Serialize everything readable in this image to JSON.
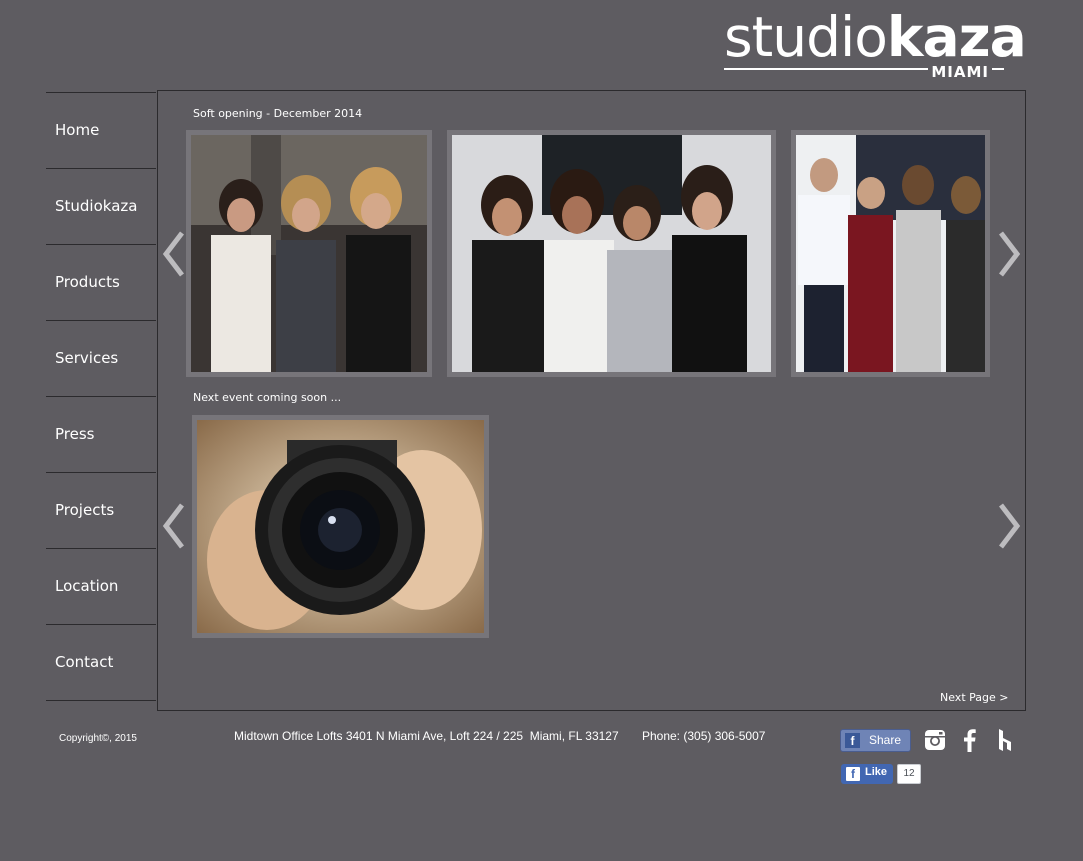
{
  "logo": {
    "text_light": "studio",
    "text_bold": "kaza",
    "city": "MIAMI"
  },
  "nav": [
    {
      "label": "Home"
    },
    {
      "label": "Studiokaza"
    },
    {
      "label": "Products"
    },
    {
      "label": "Services"
    },
    {
      "label": "Press"
    },
    {
      "label": "Projects"
    },
    {
      "label": "Location"
    },
    {
      "label": "Contact"
    }
  ],
  "gallery1": {
    "title": "Soft opening - December 2014"
  },
  "gallery2": {
    "title": "Next event coming soon ..."
  },
  "next_page": "Next Page >",
  "footer": {
    "copyright": "Copyright©, 2015",
    "address": "Midtown Office Lofts 3401 N Miami Ave, Loft 224 / 225  Miami, FL 33127       Phone: (305) 306-5007"
  },
  "share": {
    "label": "Share",
    "icon": "facebook-icon"
  },
  "like": {
    "label": "Like",
    "count": "12"
  },
  "social": [
    {
      "name": "instagram-icon"
    },
    {
      "name": "facebook-icon"
    },
    {
      "name": "houzz-icon"
    }
  ],
  "colors": {
    "background": "#5e5c61",
    "frame": "#77757a",
    "border": "#2b2a2d",
    "facebook": "#3b5998"
  }
}
